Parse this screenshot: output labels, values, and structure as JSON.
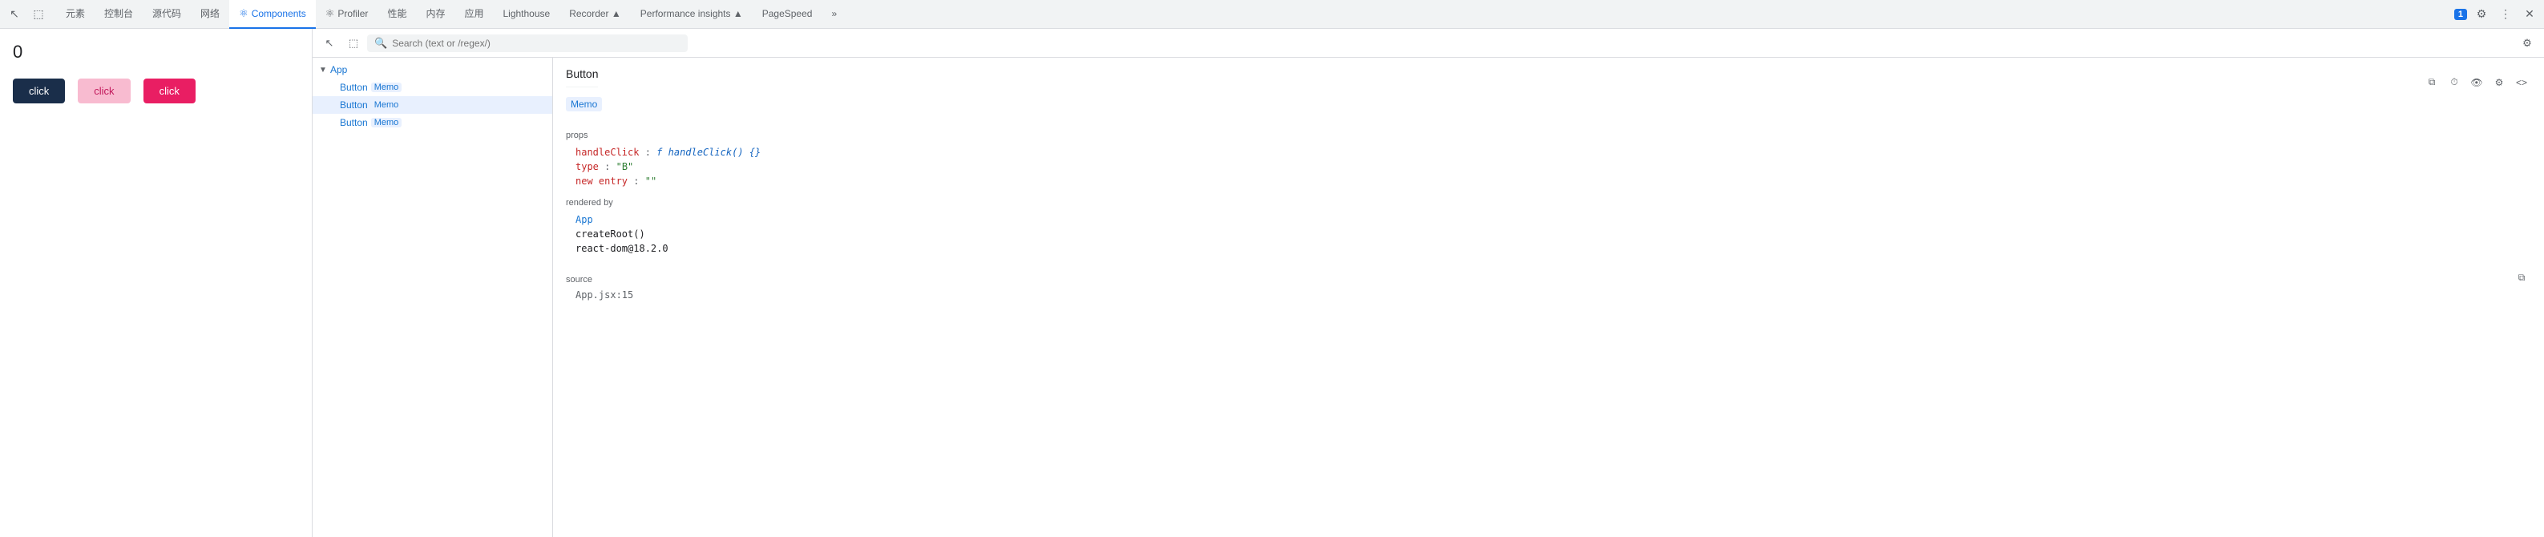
{
  "tabBar": {
    "icons": {
      "cursor": "⊹",
      "square": "▢"
    },
    "tabs": [
      {
        "id": "elements",
        "label": "元素",
        "active": false,
        "icon": ""
      },
      {
        "id": "console",
        "label": "控制台",
        "active": false,
        "icon": ""
      },
      {
        "id": "sources",
        "label": "源代码",
        "active": false,
        "icon": ""
      },
      {
        "id": "network",
        "label": "网络",
        "active": false,
        "icon": ""
      },
      {
        "id": "components",
        "label": "Components",
        "active": true,
        "icon": "⚛"
      },
      {
        "id": "profiler",
        "label": "Profiler",
        "active": false,
        "icon": "⚛"
      },
      {
        "id": "performance",
        "label": "性能",
        "active": false,
        "icon": ""
      },
      {
        "id": "memory",
        "label": "内存",
        "active": false,
        "icon": ""
      },
      {
        "id": "application",
        "label": "应用",
        "active": false,
        "icon": ""
      },
      {
        "id": "lighthouse",
        "label": "Lighthouse",
        "active": false,
        "icon": ""
      },
      {
        "id": "recorder",
        "label": "Recorder ▲",
        "active": false,
        "icon": ""
      },
      {
        "id": "perf-insights",
        "label": "Performance insights ▲",
        "active": false,
        "icon": ""
      },
      {
        "id": "pagespeed",
        "label": "PageSpeed",
        "active": false,
        "icon": ""
      },
      {
        "id": "more",
        "label": "»",
        "active": false,
        "icon": ""
      }
    ],
    "rightIcons": {
      "badge": "1",
      "settings": "⚙",
      "overflow": "⋮",
      "close": "✕"
    }
  },
  "preview": {
    "counter": "0",
    "buttons": [
      {
        "id": "btn-dark",
        "label": "click",
        "style": "dark"
      },
      {
        "id": "btn-pink",
        "label": "click",
        "style": "pink"
      },
      {
        "id": "btn-red",
        "label": "click",
        "style": "red"
      }
    ]
  },
  "toolbar": {
    "cursorIcon": "↖",
    "squareIcon": "⬚",
    "searchPlaceholder": "Search (text or /regex/)",
    "gearIcon": "⚙"
  },
  "tree": {
    "items": [
      {
        "id": "app",
        "label": "App",
        "indent": 0,
        "isComponent": true,
        "badge": "",
        "selected": false,
        "hasArrow": true,
        "arrowDown": true
      },
      {
        "id": "button-memo-1",
        "label": "Button",
        "badge": "Memo",
        "indent": 1,
        "isComponent": true,
        "selected": false,
        "hasArrow": false
      },
      {
        "id": "button-memo-2",
        "label": "Button",
        "badge": "Memo",
        "indent": 1,
        "isComponent": true,
        "selected": true,
        "hasArrow": false
      },
      {
        "id": "button-memo-3",
        "label": "Button",
        "badge": "Memo",
        "indent": 1,
        "isComponent": true,
        "selected": false,
        "hasArrow": false
      }
    ]
  },
  "detail": {
    "title": "Button",
    "memoBadge": "Memo",
    "copyIconProps": "⧉",
    "copyIconSource": "⧉",
    "sections": {
      "props": {
        "label": "props",
        "lines": [
          {
            "key": "handleClick",
            "sep": ": ",
            "valueType": "fn",
            "value": "f handleClick() {}"
          },
          {
            "key": "type",
            "sep": ": ",
            "valueType": "string",
            "value": "\"B\""
          },
          {
            "key": "new entry",
            "sep": ": ",
            "valueType": "string",
            "value": "\"\""
          }
        ]
      },
      "renderedBy": {
        "label": "rendered by",
        "items": [
          {
            "text": "App",
            "isLink": true
          },
          {
            "text": "createRoot()",
            "isLink": false
          },
          {
            "text": "react-dom@18.2.0",
            "isLink": false
          }
        ]
      },
      "source": {
        "label": "source",
        "value": "App.jsx:15"
      }
    }
  },
  "rightPanel": {
    "icons": [
      "⧉",
      "⏱",
      "👁",
      "⚙",
      "<>"
    ]
  }
}
